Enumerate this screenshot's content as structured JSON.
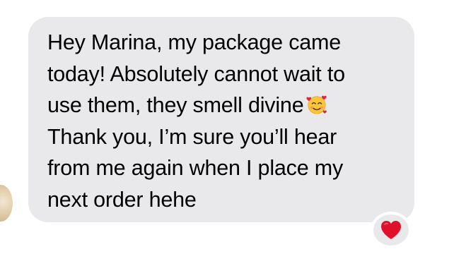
{
  "message": {
    "lines": [
      "Hey Marina, my package came",
      "today! Absolutely cannot wait to",
      "use them, they smell divine",
      "Thank you, I’m sure you’ll hear",
      "from me again when I place my",
      "next order hehe"
    ],
    "inline_emoji": "smiling-face-with-hearts-icon",
    "bubble_color": "#e9e9eb",
    "text_color": "#000000"
  },
  "reaction": {
    "icon": "red-heart-icon",
    "color": "#e0102b"
  },
  "sender": {
    "avatar_icon": "avatar"
  }
}
